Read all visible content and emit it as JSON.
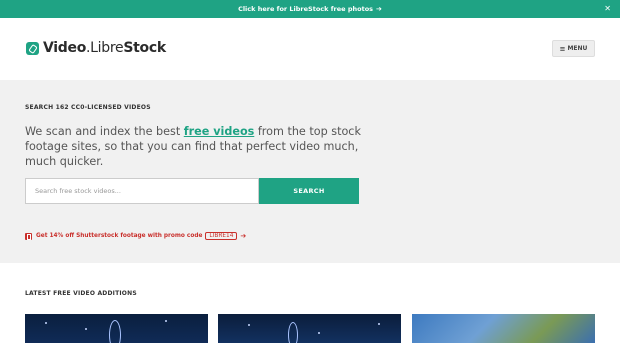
{
  "topbar": {
    "text": "Click here for LibreStock free photos",
    "arrow": "➔",
    "close": "✕"
  },
  "header": {
    "logo_bold": "Video",
    "logo_light": ".Libre",
    "logo_bold2": "Stock",
    "menu_icon": "≡",
    "menu_label": "MENU"
  },
  "hero": {
    "kicker": "SEARCH 162 CC0-LICENSED VIDEOS",
    "text_before": "We scan and index the best ",
    "text_link": "free videos",
    "text_after": " from the top stock footage sites, so that you can find that perfect video much, much quicker.",
    "search_placeholder": "Search free stock videos...",
    "search_button": "SEARCH",
    "promo_text": "Get 14% off Shutterstock footage with promo code",
    "promo_code": "LIBRE14",
    "promo_arrow": "➔"
  },
  "latest": {
    "title": "LATEST FREE VIDEO ADDITIONS"
  },
  "colors": {
    "accent": "#1fa384",
    "promo": "#c9302c",
    "hero_bg": "#f1f1f1"
  }
}
